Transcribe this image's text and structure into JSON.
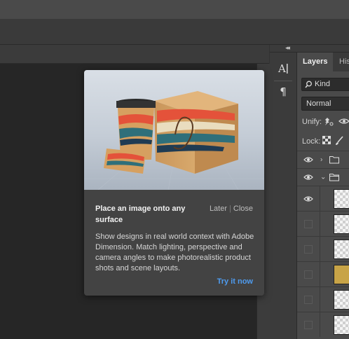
{
  "panel": {
    "tabs": [
      "Layers",
      "His"
    ],
    "kind_filter": "Kind",
    "blend_mode": "Normal",
    "unify_label": "Unify:",
    "lock_label": "Lock:"
  },
  "popup": {
    "title": "Place an image onto any surface",
    "later": "Later",
    "close": "Close",
    "body": "Show designs in real world context with Adobe Dimension. Match lighting, perspective and camera angles to make photorealistic product shots and scene layouts.",
    "cta": "Try it now"
  },
  "colors": {
    "accent": "#4e9cf0",
    "popup_bg": "#434343",
    "panel_bg": "#4a4a4a"
  },
  "icons": [
    "collapse-chevron-icon",
    "character-icon",
    "paragraph-icon",
    "search-icon",
    "pin-icon",
    "link-icon",
    "eye-icon",
    "brush-icon",
    "checkerboard-icon",
    "folder-icon"
  ]
}
